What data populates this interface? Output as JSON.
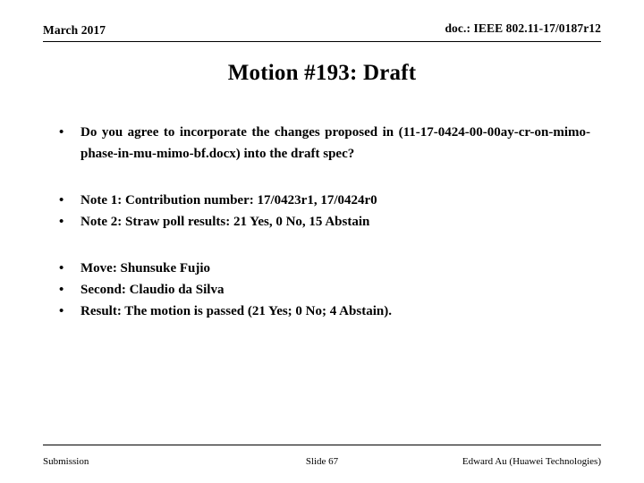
{
  "header": {
    "date": "March 2017",
    "doc_id": "doc.: IEEE 802.11-17/0187r12"
  },
  "title": "Motion #193:  Draft",
  "body": {
    "bullet_marker": "•",
    "groups": [
      {
        "items": [
          "Do you agree to incorporate the changes proposed in (11-17-0424-00-00ay-cr-on-mimo-phase-in-mu-mimo-bf.docx)  into  the  draft  spec?"
        ]
      },
      {
        "items": [
          "Note 1:  Contribution number:  17/0423r1, 17/0424r0",
          "Note 2:  Straw poll results:  21 Yes, 0 No, 15 Abstain"
        ]
      },
      {
        "items": [
          "Move:  Shunsuke Fujio",
          "Second:  Claudio da Silva",
          "Result:  The motion is passed (21 Yes; 0 No; 4 Abstain)."
        ]
      }
    ]
  },
  "footer": {
    "left": "Submission",
    "center": "Slide 67",
    "right": "Edward Au (Huawei Technologies)"
  }
}
